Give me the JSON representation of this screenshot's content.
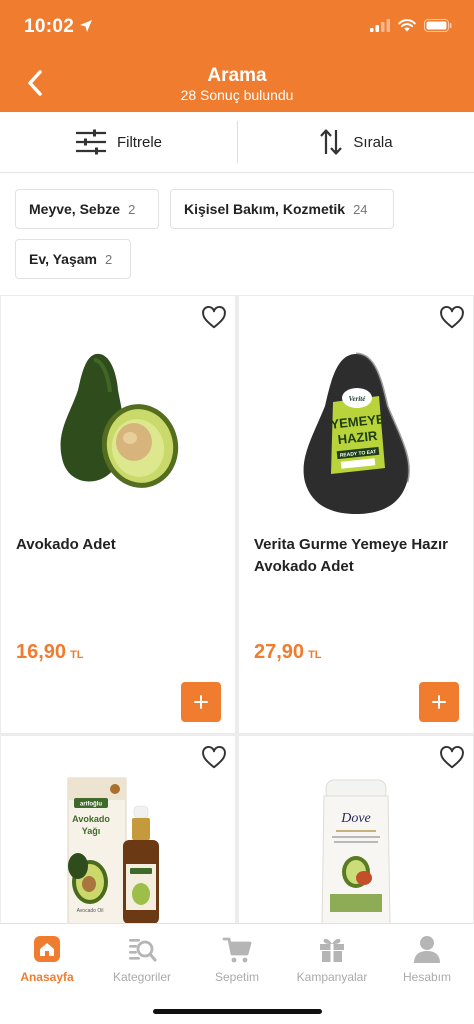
{
  "status_bar": {
    "time": "10:02"
  },
  "nav": {
    "title": "Arama",
    "subtitle": "28 Sonuç bulundu"
  },
  "toolbar": {
    "filter_label": "Filtrele",
    "sort_label": "Sırala"
  },
  "chips": [
    {
      "label": "Meyve, Sebze",
      "count": "2"
    },
    {
      "label": "Kişisel Bakım, Kozmetik",
      "count": "24"
    },
    {
      "label": "Ev, Yaşam",
      "count": "2"
    }
  ],
  "products": [
    {
      "name": "Avokado Adet",
      "price": "16,90",
      "currency": "TL"
    },
    {
      "name": "Verita Gurme Yemeye Hazır Avokado Adet",
      "price": "27,90",
      "currency": "TL",
      "label_text": {
        "brand": "Verité",
        "line1": "YEMEYE",
        "line2": "HAZIR",
        "badge": "READY TO EAT"
      }
    },
    {
      "name": "",
      "price": "",
      "currency": "",
      "label_text": {
        "brand": "arifoğlu",
        "title1": "Avokado",
        "title2": "Yağı",
        "small": "Avocado Oil"
      }
    },
    {
      "name": "",
      "price": "",
      "currency": "",
      "label_text": {
        "brand": "Dove"
      }
    }
  ],
  "tabs": [
    {
      "label": "Anasayfa",
      "icon": "home-icon",
      "active": true
    },
    {
      "label": "Kategoriler",
      "icon": "category-search-icon",
      "active": false
    },
    {
      "label": "Sepetim",
      "icon": "cart-icon",
      "active": false
    },
    {
      "label": "Kampanyalar",
      "icon": "gift-icon",
      "active": false
    },
    {
      "label": "Hesabım",
      "icon": "user-icon",
      "active": false
    }
  ],
  "colors": {
    "accent": "#F07C2F",
    "inactive": "#AAAAAA",
    "divider": "#ECECEC"
  }
}
